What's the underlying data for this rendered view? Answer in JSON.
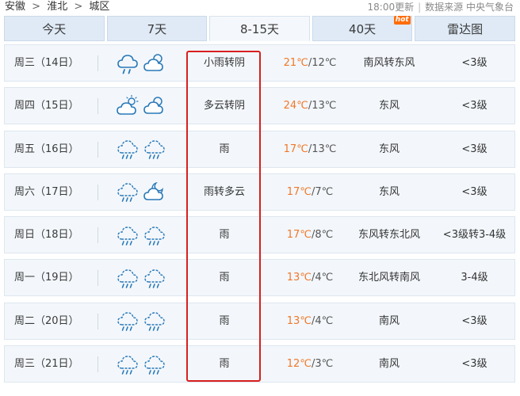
{
  "breadcrumb": [
    "安徽",
    "淮北",
    "城区"
  ],
  "breadcrumb_sep": ">",
  "update_info": {
    "time": "18:00更新",
    "source": "数据来源 中央气象台"
  },
  "tabs": [
    {
      "label": "今天"
    },
    {
      "label": "7天"
    },
    {
      "label": "8-15天"
    },
    {
      "label": "40天",
      "badge": "hot"
    },
    {
      "label": "雷达图"
    }
  ],
  "active_tab": "8-15天",
  "forecast": [
    {
      "date": "周三（14日）",
      "icons": [
        "rain-cloud-icon",
        "cloud-sun-icon"
      ],
      "desc": "小雨转阴",
      "high": "21℃",
      "low": "/12℃",
      "wind": "南风转东风",
      "level": "<3级"
    },
    {
      "date": "周四（15日）",
      "icons": [
        "sun-cloud-icon",
        "cloud-sun-icon"
      ],
      "desc": "多云转阴",
      "high": "24℃",
      "low": "/13℃",
      "wind": "东风",
      "level": "<3级"
    },
    {
      "date": "周五（16日）",
      "icons": [
        "rain-icon",
        "rain-icon"
      ],
      "desc": "雨",
      "high": "17℃",
      "low": "/13℃",
      "wind": "东风",
      "level": "<3级"
    },
    {
      "date": "周六（17日）",
      "icons": [
        "rain-icon",
        "cloud-moon-icon"
      ],
      "desc": "雨转多云",
      "high": "17℃",
      "low": "/7℃",
      "wind": "东风",
      "level": "<3级"
    },
    {
      "date": "周日（18日）",
      "icons": [
        "rain-icon",
        "rain-icon"
      ],
      "desc": "雨",
      "high": "17℃",
      "low": "/8℃",
      "wind": "东风转东北风",
      "level": "<3级转3-4级"
    },
    {
      "date": "周一（19日）",
      "icons": [
        "rain-icon",
        "rain-icon"
      ],
      "desc": "雨",
      "high": "13℃",
      "low": "/4℃",
      "wind": "东北风转南风",
      "level": "3-4级"
    },
    {
      "date": "周二（20日）",
      "icons": [
        "rain-icon",
        "rain-icon"
      ],
      "desc": "雨",
      "high": "13℃",
      "low": "/4℃",
      "wind": "南风",
      "level": "<3级"
    },
    {
      "date": "周三（21日）",
      "icons": [
        "rain-icon",
        "rain-icon"
      ],
      "desc": "雨",
      "high": "12℃",
      "low": "/3℃",
      "wind": "南风",
      "level": "<3级"
    }
  ],
  "colors": {
    "high_temp": "#f0782a",
    "icon": "#2a79b8",
    "highlight_box": "#d91f1f",
    "tab_bg": "#dfeaf6",
    "row_bg": "#f3f7fb"
  }
}
